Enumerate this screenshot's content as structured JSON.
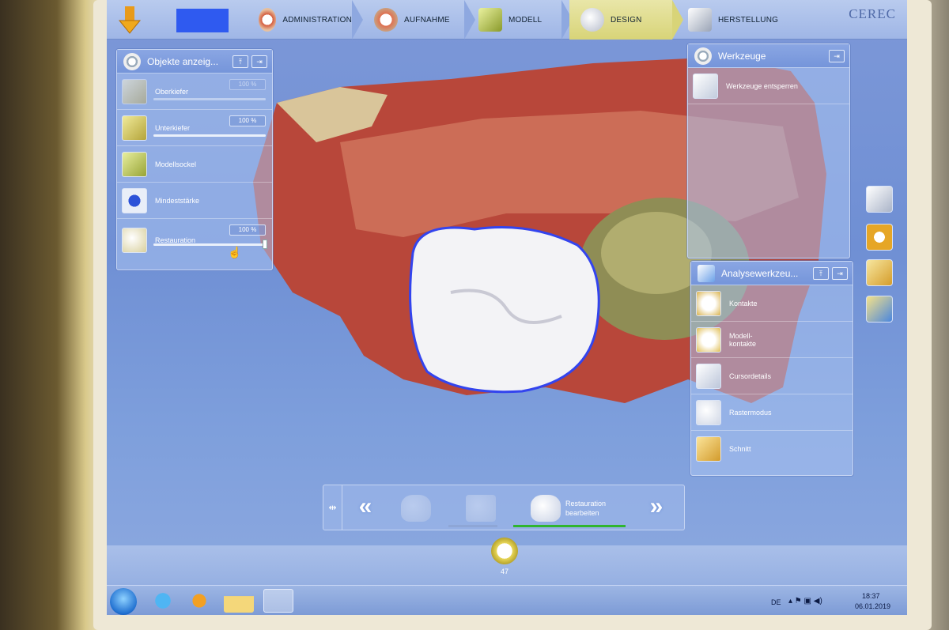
{
  "topbar": {
    "phases": [
      {
        "label": "ADMINISTRATION"
      },
      {
        "label": "AUFNAHME"
      },
      {
        "label": "MODELL"
      },
      {
        "label": "DESIGN",
        "active": true
      },
      {
        "label": "HERSTELLUNG"
      }
    ],
    "brand": "CEREC"
  },
  "objects_panel": {
    "title": "Objekte anzeig...",
    "rows": [
      {
        "label": "Oberkiefer",
        "value": "100 %",
        "level": 1.0
      },
      {
        "label": "Unterkiefer",
        "value": "100 %",
        "level": 1.0
      },
      {
        "label": "Modellsockel"
      },
      {
        "label": "Mindeststärke"
      },
      {
        "label": "Restauration",
        "value": "100 %",
        "level": 1.0
      }
    ]
  },
  "tools_panel": {
    "title": "Werkzeuge",
    "items": [
      {
        "label": "Werkzeuge entsperren"
      }
    ]
  },
  "analysis_panel": {
    "title": "Analysewerkzeu...",
    "items": [
      {
        "label": "Kontakte"
      },
      {
        "label": "Modell-\nkontakte"
      },
      {
        "label": "Cursordetails"
      },
      {
        "label": "Rastermodus"
      },
      {
        "label": "Schnitt"
      }
    ]
  },
  "stepnav": {
    "current_step": "Restauration\nbearbeiten"
  },
  "tooth": {
    "number": "47"
  },
  "taskbar": {
    "language": "DE",
    "time": "18:37",
    "date": "06.01.2019"
  },
  "colors": {
    "accent_green": "#2fb52f",
    "patient_field": "#2f5af0",
    "screen_bg": "#7d98d8"
  }
}
